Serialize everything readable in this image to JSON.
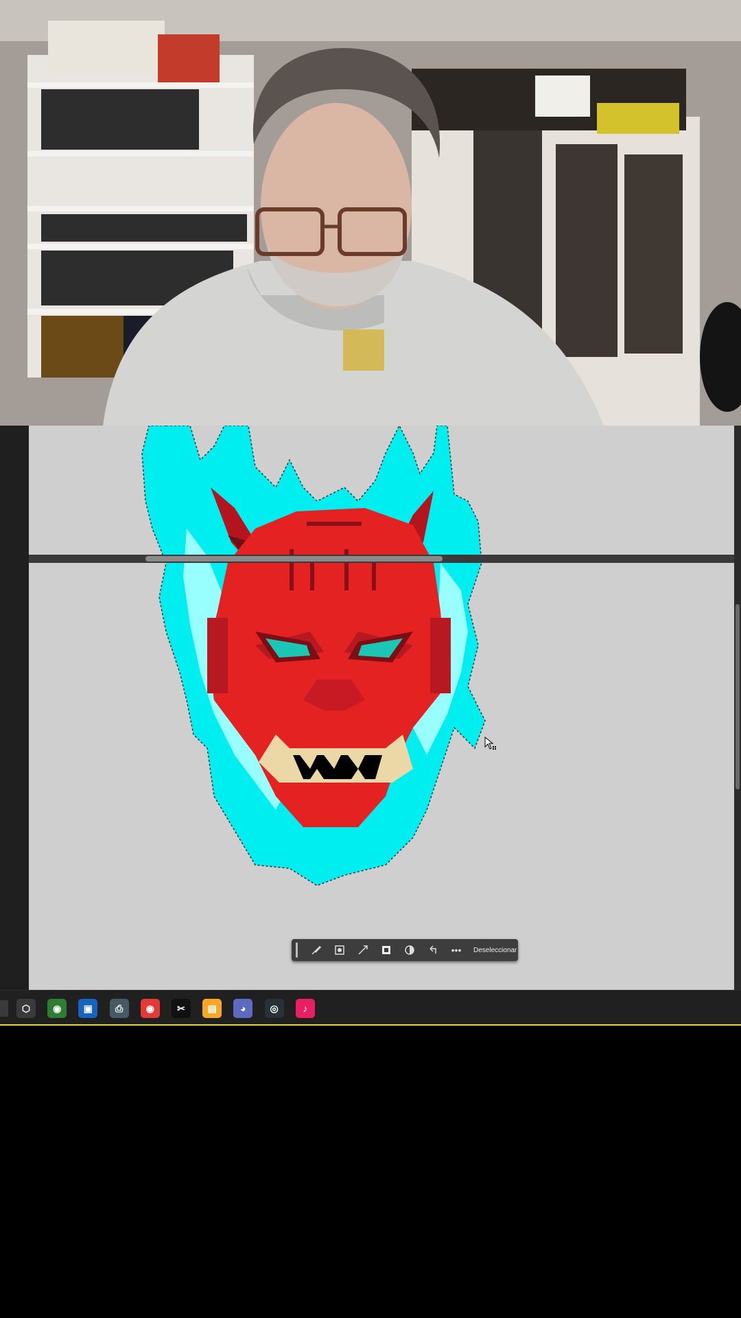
{
  "context_toolbar": {
    "deselect_label": "Deseleccionar",
    "more_glyph": "•••"
  },
  "taskbar": {
    "icons": [
      {
        "name": "3d-cube-icon",
        "glyph": "⬡",
        "color": "#3a3a3a"
      },
      {
        "name": "chrome-profile-icon",
        "glyph": "◉",
        "color": "#2e7d32"
      },
      {
        "name": "remote-desktop-icon",
        "glyph": "▣",
        "color": "#1565c0"
      },
      {
        "name": "printer-icon",
        "glyph": "⎙",
        "color": "#455a64"
      },
      {
        "name": "chrome-icon",
        "glyph": "◉",
        "color": "#e53935"
      },
      {
        "name": "capcut-icon",
        "glyph": "✂",
        "color": "#111111"
      },
      {
        "name": "file-explorer-icon",
        "glyph": "▤",
        "color": "#f9a825"
      },
      {
        "name": "discord-icon",
        "glyph": "◕",
        "color": "#5c6bc0"
      },
      {
        "name": "obs-icon",
        "glyph": "◎",
        "color": "#263238"
      },
      {
        "name": "tiktok-icon",
        "glyph": "♪",
        "color": "#e91e63"
      }
    ]
  },
  "colors": {
    "canvas_bg": "#cfcfcf",
    "flame": "#00f0f0",
    "mask_red": "#e52222",
    "accent_yellow": "#d6cf4a"
  }
}
